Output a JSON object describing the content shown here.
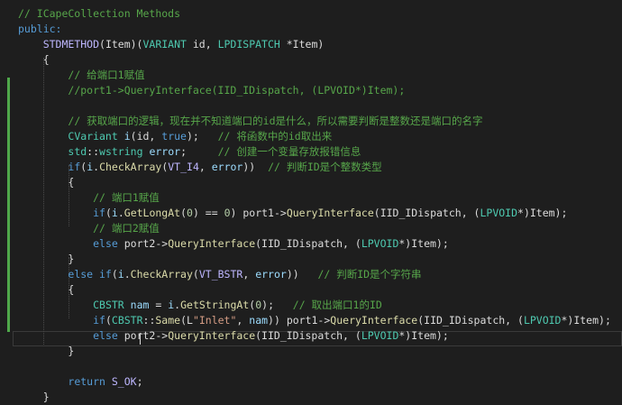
{
  "lines": [
    {
      "tokens": [
        {
          "t": "// ICapeCollection Methods",
          "c": "cm"
        }
      ]
    },
    {
      "tokens": [
        {
          "t": "public:",
          "c": "kw"
        }
      ]
    },
    {
      "tokens": [
        {
          "t": "    "
        },
        {
          "t": "STDMETHOD",
          "c": "mac"
        },
        {
          "t": "(Item)("
        },
        {
          "t": "VARIANT",
          "c": "ty"
        },
        {
          "t": " id, "
        },
        {
          "t": "LPDISPATCH",
          "c": "ty"
        },
        {
          "t": " *Item)"
        }
      ]
    },
    {
      "tokens": [
        {
          "t": "    {"
        }
      ]
    },
    {
      "tokens": [
        {
          "t": "        "
        },
        {
          "t": "// 给端口1赋值",
          "c": "cm"
        }
      ]
    },
    {
      "tokens": [
        {
          "t": "        "
        },
        {
          "t": "//port1->QueryInterface(IID_IDispatch, (LPVOID*)Item);",
          "c": "cm"
        }
      ]
    },
    {
      "tokens": [
        {
          "t": ""
        }
      ]
    },
    {
      "tokens": [
        {
          "t": "        "
        },
        {
          "t": "// 获取端口的逻辑，现在并不知道端口的id是什么，所以需要判断是整数还是端口的名字",
          "c": "cm"
        }
      ]
    },
    {
      "tokens": [
        {
          "t": "        "
        },
        {
          "t": "CVariant",
          "c": "ty"
        },
        {
          "t": " "
        },
        {
          "t": "i",
          "c": "vr"
        },
        {
          "t": "(id, "
        },
        {
          "t": "true",
          "c": "kw"
        },
        {
          "t": ");   "
        },
        {
          "t": "// 将函数中的id取出来",
          "c": "cm"
        }
      ]
    },
    {
      "tokens": [
        {
          "t": "        "
        },
        {
          "t": "std",
          "c": "ty"
        },
        {
          "t": "::"
        },
        {
          "t": "wstring",
          "c": "ty"
        },
        {
          "t": " "
        },
        {
          "t": "error",
          "c": "vr"
        },
        {
          "t": ";     "
        },
        {
          "t": "// 创建一个变量存放报错信息",
          "c": "cm"
        }
      ]
    },
    {
      "tokens": [
        {
          "t": "        "
        },
        {
          "t": "if",
          "c": "kw"
        },
        {
          "t": "("
        },
        {
          "t": "i",
          "c": "vr"
        },
        {
          "t": "."
        },
        {
          "t": "CheckArray",
          "c": "fn"
        },
        {
          "t": "("
        },
        {
          "t": "VT_I4",
          "c": "mac"
        },
        {
          "t": ", "
        },
        {
          "t": "error",
          "c": "vr"
        },
        {
          "t": "))  "
        },
        {
          "t": "// 判断ID是个整数类型",
          "c": "cm"
        }
      ]
    },
    {
      "tokens": [
        {
          "t": "        {"
        }
      ]
    },
    {
      "tokens": [
        {
          "t": "            "
        },
        {
          "t": "// 端口1赋值",
          "c": "cm"
        }
      ]
    },
    {
      "tokens": [
        {
          "t": "            "
        },
        {
          "t": "if",
          "c": "kw"
        },
        {
          "t": "("
        },
        {
          "t": "i",
          "c": "vr"
        },
        {
          "t": "."
        },
        {
          "t": "GetLongAt",
          "c": "fn"
        },
        {
          "t": "("
        },
        {
          "t": "0",
          "c": "num"
        },
        {
          "t": ") == "
        },
        {
          "t": "0",
          "c": "num"
        },
        {
          "t": ") port1->"
        },
        {
          "t": "QueryInterface",
          "c": "fn"
        },
        {
          "t": "(IID_IDispatch, ("
        },
        {
          "t": "LPVOID",
          "c": "ty"
        },
        {
          "t": "*)Item);"
        }
      ]
    },
    {
      "tokens": [
        {
          "t": "            "
        },
        {
          "t": "// 端口2赋值",
          "c": "cm"
        }
      ]
    },
    {
      "tokens": [
        {
          "t": "            "
        },
        {
          "t": "else",
          "c": "kw"
        },
        {
          "t": " port2->"
        },
        {
          "t": "QueryInterface",
          "c": "fn"
        },
        {
          "t": "(IID_IDispatch, ("
        },
        {
          "t": "LPVOID",
          "c": "ty"
        },
        {
          "t": "*)Item);"
        }
      ]
    },
    {
      "tokens": [
        {
          "t": "        }"
        }
      ]
    },
    {
      "tokens": [
        {
          "t": "        "
        },
        {
          "t": "else if",
          "c": "kw"
        },
        {
          "t": "("
        },
        {
          "t": "i",
          "c": "vr"
        },
        {
          "t": "."
        },
        {
          "t": "CheckArray",
          "c": "fn"
        },
        {
          "t": "("
        },
        {
          "t": "VT_BSTR",
          "c": "mac"
        },
        {
          "t": ", "
        },
        {
          "t": "error",
          "c": "vr"
        },
        {
          "t": "))   "
        },
        {
          "t": "// 判断ID是个字符串",
          "c": "cm"
        }
      ]
    },
    {
      "tokens": [
        {
          "t": "        {"
        }
      ]
    },
    {
      "tokens": [
        {
          "t": "            "
        },
        {
          "t": "CBSTR",
          "c": "ty"
        },
        {
          "t": " "
        },
        {
          "t": "nam",
          "c": "vr"
        },
        {
          "t": " = "
        },
        {
          "t": "i",
          "c": "vr"
        },
        {
          "t": "."
        },
        {
          "t": "GetStringAt",
          "c": "fn"
        },
        {
          "t": "("
        },
        {
          "t": "0",
          "c": "num"
        },
        {
          "t": ");   "
        },
        {
          "t": "// 取出端口1的ID",
          "c": "cm"
        }
      ]
    },
    {
      "tokens": [
        {
          "t": "            "
        },
        {
          "t": "if",
          "c": "kw"
        },
        {
          "t": "("
        },
        {
          "t": "CBSTR",
          "c": "ty"
        },
        {
          "t": "::"
        },
        {
          "t": "Same",
          "c": "fn"
        },
        {
          "t": "(L"
        },
        {
          "t": "\"Inlet\"",
          "c": "str"
        },
        {
          "t": ", "
        },
        {
          "t": "nam",
          "c": "vr"
        },
        {
          "t": ")) port1->"
        },
        {
          "t": "QueryInterface",
          "c": "fn"
        },
        {
          "t": "(IID_IDispatch, ("
        },
        {
          "t": "LPVOID",
          "c": "ty"
        },
        {
          "t": "*)Item);"
        }
      ]
    },
    {
      "tokens": [
        {
          "t": "            "
        },
        {
          "t": "else",
          "c": "kw"
        },
        {
          "t": " port2->"
        },
        {
          "t": "QueryInterface",
          "c": "fn"
        },
        {
          "t": "(IID_IDispatch, ("
        },
        {
          "t": "LPVOID",
          "c": "ty"
        },
        {
          "t": "*)Item);"
        }
      ]
    },
    {
      "tokens": [
        {
          "t": "        }"
        }
      ]
    },
    {
      "tokens": [
        {
          "t": ""
        }
      ]
    },
    {
      "tokens": [
        {
          "t": "        "
        },
        {
          "t": "return",
          "c": "kw"
        },
        {
          "t": " "
        },
        {
          "t": "S_OK",
          "c": "mac"
        },
        {
          "t": ";"
        }
      ]
    },
    {
      "tokens": [
        {
          "t": "    }"
        }
      ]
    }
  ]
}
